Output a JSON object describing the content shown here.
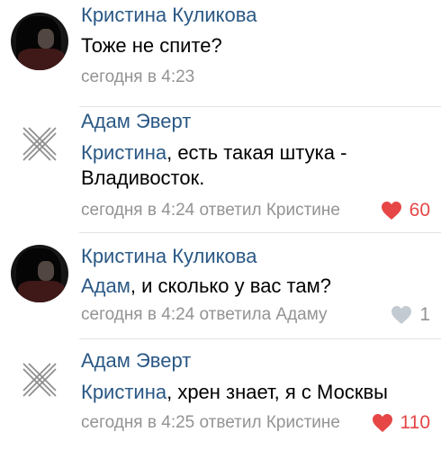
{
  "colors": {
    "link": "#2a5885",
    "meta": "#939393",
    "like_active": "#e64646",
    "like_inactive": "#c4cad1"
  },
  "comments": [
    {
      "author": "Кристина Куликова",
      "avatar": "user-photo",
      "mention": "",
      "text": "Тоже не спите?",
      "meta": "сегодня в 4:23",
      "likes": null,
      "liked": false
    },
    {
      "author": "Адам Эверт",
      "avatar": "deactivated-icon",
      "mention": "Кристина",
      "text_line1": ", есть такая штука -",
      "text_line2": "Владивосток.",
      "meta": "сегодня в 4:24 ответил Кристине",
      "likes": "60",
      "liked": true
    },
    {
      "author": "Кристина Куликова",
      "avatar": "user-photo",
      "mention": "Адам",
      "text": ", и сколько у вас там?",
      "meta": "сегодня в 4:24 ответила Адаму",
      "likes": "1",
      "liked": false
    },
    {
      "author": "Адам Эверт",
      "avatar": "deactivated-icon",
      "mention": "Кристина",
      "text": ", хрен знает, я с Москвы",
      "meta": "сегодня в 4:25 ответил Кристине",
      "likes": "110",
      "liked": true
    }
  ]
}
